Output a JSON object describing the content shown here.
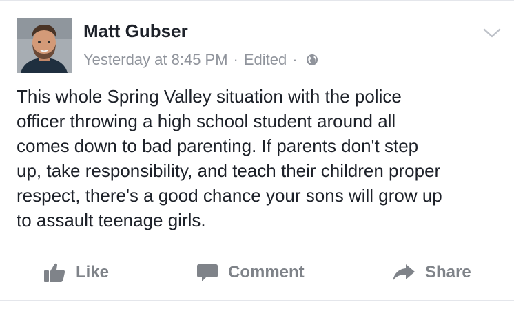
{
  "post": {
    "author": "Matt Gubser",
    "timestamp": "Yesterday at 8:45 PM",
    "separator": "·",
    "edited_label": "Edited",
    "privacy_icon": "globe-icon",
    "menu_icon": "chevron-down-icon",
    "avatar": "profile-photo",
    "text_lines": [
      "This whole Spring Valley situation with the police",
      "officer throwing a high school student around all",
      "comes down to bad parenting. If parents don't step",
      "up, take responsibility, and teach their children proper",
      "respect, there's a good chance your sons will grow up",
      "to assault teenage girls."
    ]
  },
  "actions": {
    "like_label": "Like",
    "like_icon": "thumbs-up-icon",
    "comment_label": "Comment",
    "comment_icon": "speech-bubble-icon",
    "share_label": "Share",
    "share_icon": "share-arrow-icon"
  },
  "colors": {
    "text": "#1d2129",
    "meta": "#90949c",
    "action": "#7f8389",
    "divider": "#e4e6eb"
  }
}
